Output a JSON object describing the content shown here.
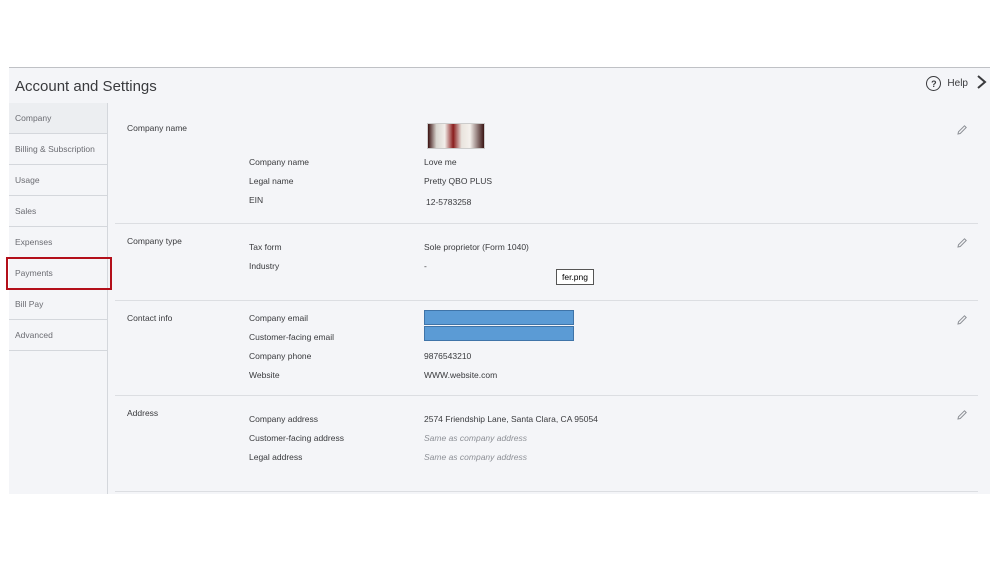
{
  "header": {
    "title": "Account and Settings",
    "help_label": "Help",
    "help_icon": "question-circle-icon"
  },
  "sidebar": {
    "items": [
      {
        "label": "Company"
      },
      {
        "label": "Billing & Subscription"
      },
      {
        "label": "Usage"
      },
      {
        "label": "Sales"
      },
      {
        "label": "Expenses"
      },
      {
        "label": "Payments"
      },
      {
        "label": "Bill Pay"
      },
      {
        "label": "Advanced"
      }
    ]
  },
  "company_name": {
    "title": "Company name",
    "rows": [
      {
        "label": "Company name",
        "value": "Love me"
      },
      {
        "label": "Legal name",
        "value": "Pretty QBO PLUS"
      },
      {
        "label": "EIN",
        "value": "12-5783258"
      }
    ]
  },
  "company_type": {
    "title": "Company type",
    "rows": [
      {
        "label": "Tax form",
        "value": "Sole proprietor (Form 1040)"
      },
      {
        "label": "Industry",
        "value": "-"
      }
    ],
    "tooltip": "fer.png"
  },
  "contact_info": {
    "title": "Contact info",
    "rows": [
      {
        "label": "Company email",
        "value": ""
      },
      {
        "label": "Customer-facing email",
        "value": ""
      },
      {
        "label": "Company phone",
        "value": "9876543210"
      },
      {
        "label": "Website",
        "value": "WWW.website.com"
      }
    ]
  },
  "address": {
    "title": "Address",
    "rows": [
      {
        "label": "Company address",
        "value": "2574 Friendship Lane, Santa Clara, CA 95054"
      },
      {
        "label": "Customer-facing address",
        "value": "Same as company address"
      },
      {
        "label": "Legal address",
        "value": "Same as company address"
      }
    ]
  },
  "colors": {
    "highlight": "#b30f1a",
    "redaction": "#5b9bd5"
  }
}
